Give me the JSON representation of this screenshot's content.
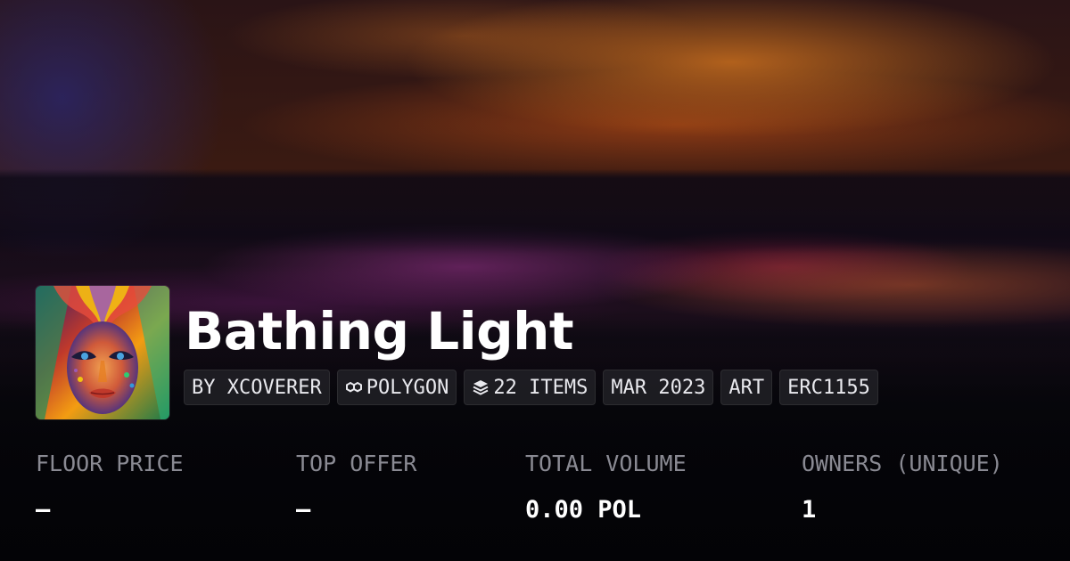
{
  "collection": {
    "title": "Bathing Light",
    "avatar_alt": "collection-avatar",
    "tags": [
      {
        "label": "BY XCOVERER",
        "icon": ""
      },
      {
        "label": "POLYGON",
        "icon": "polygon-icon"
      },
      {
        "label": "22 ITEMS",
        "icon": "layers-icon"
      },
      {
        "label": "MAR 2023",
        "icon": ""
      },
      {
        "label": "ART",
        "icon": ""
      },
      {
        "label": "ERC1155",
        "icon": ""
      }
    ]
  },
  "stats": {
    "floor_price": {
      "label": "FLOOR PRICE",
      "value": "–"
    },
    "top_offer": {
      "label": "TOP OFFER",
      "value": "–"
    },
    "total_volume": {
      "label": "TOTAL VOLUME",
      "value": "0.00 POL"
    },
    "owners": {
      "label": "OWNERS (UNIQUE)",
      "value": "1"
    }
  },
  "colors": {
    "text_primary": "#ffffff",
    "text_muted": "#8a8a93",
    "tag_bg": "#222228"
  }
}
